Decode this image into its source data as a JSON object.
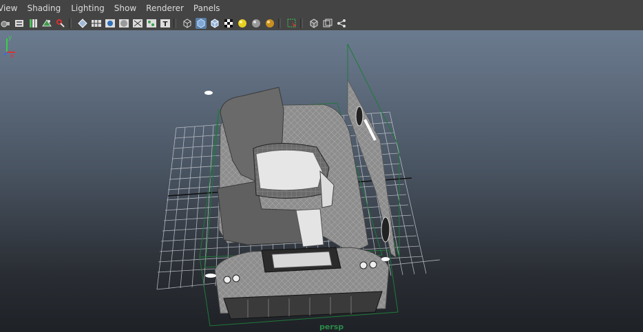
{
  "menu": [
    {
      "id": "view",
      "label": "View"
    },
    {
      "id": "shading",
      "label": "Shading"
    },
    {
      "id": "lighting",
      "label": "Lighting"
    },
    {
      "id": "show",
      "label": "Show"
    },
    {
      "id": "renderer",
      "label": "Renderer"
    },
    {
      "id": "panels",
      "label": "Panels"
    }
  ],
  "toolbar": {
    "icons": [
      "select-camera-icon",
      "camera-attributes-icon",
      "bookmarks-icon",
      "image-plane-icon",
      "two-d-pan-zoom-icon",
      "grease-pencil-icon",
      "grid-icon",
      "film-gate-icon",
      "resolution-gate-icon",
      "gate-mask-icon",
      "field-chart-icon",
      "safe-action-icon",
      "safe-title-icon",
      "wireframe-icon",
      "smooth-shade-icon",
      "wireframe-on-shaded-icon",
      "textured-icon",
      "use-all-lights-icon",
      "shadows-icon",
      "screen-space-ao-icon",
      "isolate-select-icon",
      "xray-icon",
      "xray-joints-icon",
      "motion-blur-icon"
    ]
  },
  "viewport": {
    "camera_label": "persp",
    "axis": {
      "y": "y",
      "x": "x"
    }
  },
  "colors": {
    "menubar_bg": "#444444",
    "camera_label": "#2c8a4a",
    "grid_line": "#c8ccd2",
    "bbox_green": "#1f7a3a"
  }
}
